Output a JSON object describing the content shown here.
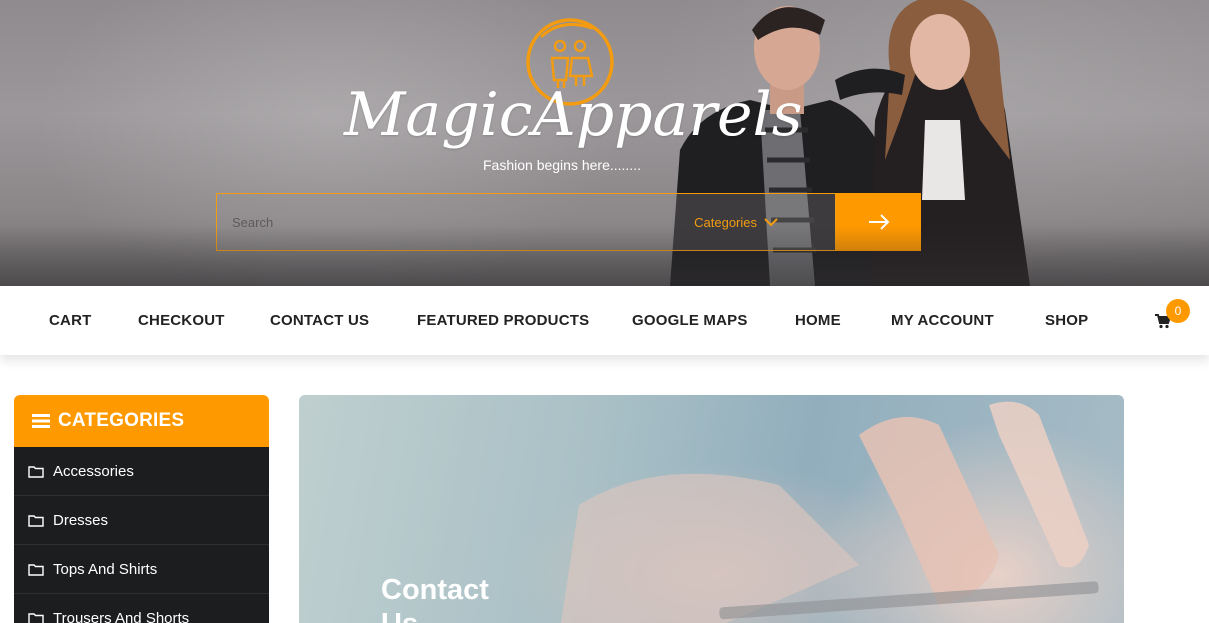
{
  "site": {
    "brand": "MagicApparels",
    "tagline": "Fashion begins here........"
  },
  "search": {
    "placeholder": "Search",
    "category_label": "Categories"
  },
  "nav": {
    "items": [
      "CART",
      "CHECKOUT",
      "CONTACT US",
      "FEATURED PRODUCTS",
      "GOOGLE MAPS",
      "HOME",
      "MY ACCOUNT",
      "SHOP"
    ],
    "cart_count": "0"
  },
  "sidebar": {
    "heading": "CATEGORIES",
    "items": [
      "Accessories",
      "Dresses",
      "Tops And Shirts",
      "Trousers And Shorts"
    ]
  },
  "banner": {
    "title": "Contact Us"
  },
  "colors": {
    "accent": "#ff9900",
    "sidebar_bg": "#1c1d1f"
  }
}
